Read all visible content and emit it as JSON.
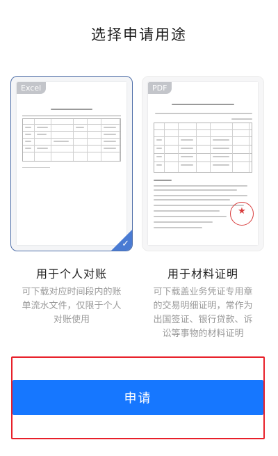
{
  "page": {
    "title": "选择申请用途"
  },
  "options": [
    {
      "badge": "Excel",
      "label": "用于个人对账",
      "description": "可下载对应时间段内的账单流水文件，仅限于个人对账使用",
      "selected": true
    },
    {
      "badge": "PDF",
      "label": "用于材料证明",
      "description": "可下载盖业务凭证专用章的交易明细证明，常作为出国签证、银行贷款、诉讼等事物的材料证明",
      "selected": false
    }
  ],
  "apply_button": {
    "label": "申请"
  },
  "colors": {
    "primary": "#1677ff",
    "selected_border": "#4e6ea8",
    "highlight": "#e8202a",
    "stamp": "#d83b3b",
    "muted_text": "#9a9a9a"
  },
  "icons": {
    "selected_check": "check-icon",
    "pdf_stamp": "seal-stamp-icon"
  }
}
